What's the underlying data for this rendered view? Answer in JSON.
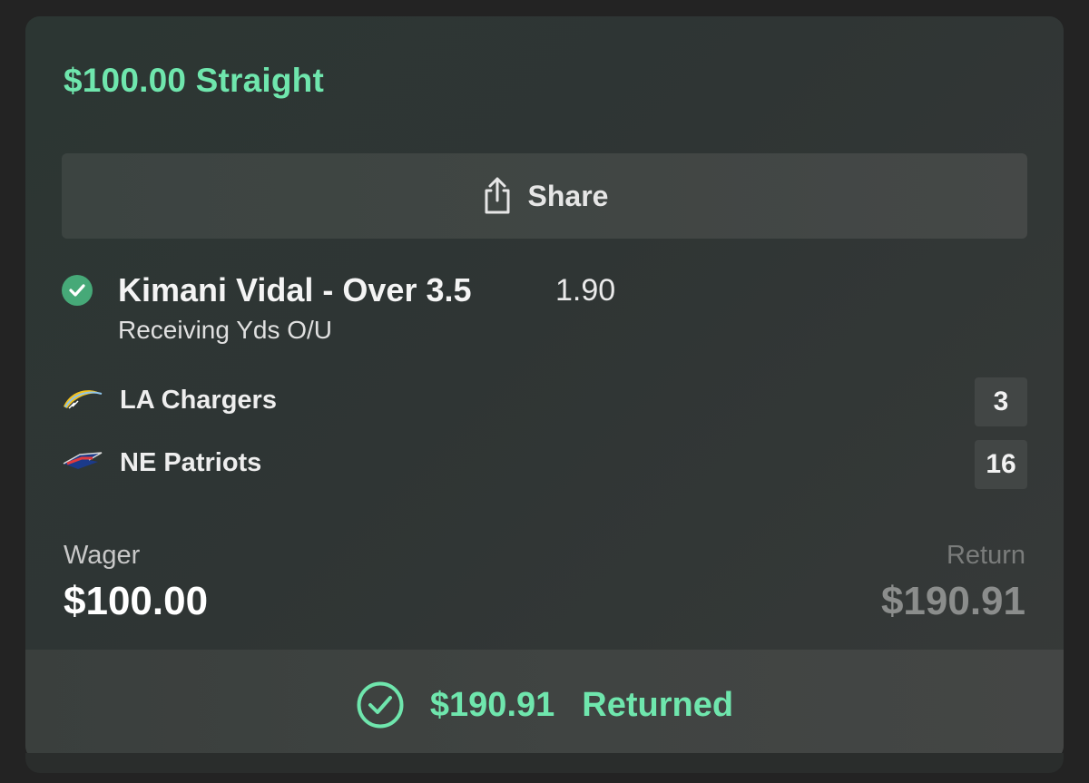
{
  "bet": {
    "title": "$100.00 Straight"
  },
  "share": {
    "label": "Share",
    "icon": "share-icon"
  },
  "selection": {
    "status_icon": "check-circle-icon",
    "title": "Kimani Vidal - Over 3.5",
    "odds": "1.90",
    "market": "Receiving Yds O/U"
  },
  "teams": [
    {
      "name": "LA Chargers",
      "score": "3",
      "logo": "chargers-logo"
    },
    {
      "name": "NE Patriots",
      "score": "16",
      "logo": "patriots-logo"
    }
  ],
  "summary": {
    "wager_label": "Wager",
    "wager_value": "$100.00",
    "return_label": "Return",
    "return_value": "$190.91"
  },
  "footer": {
    "amount": "$190.91",
    "label": "Returned",
    "icon": "check-circle-outline-icon"
  },
  "colors": {
    "accent": "#6fe6ad",
    "success_badge": "#46a978",
    "background": "#232323",
    "card": "#2f3534"
  }
}
